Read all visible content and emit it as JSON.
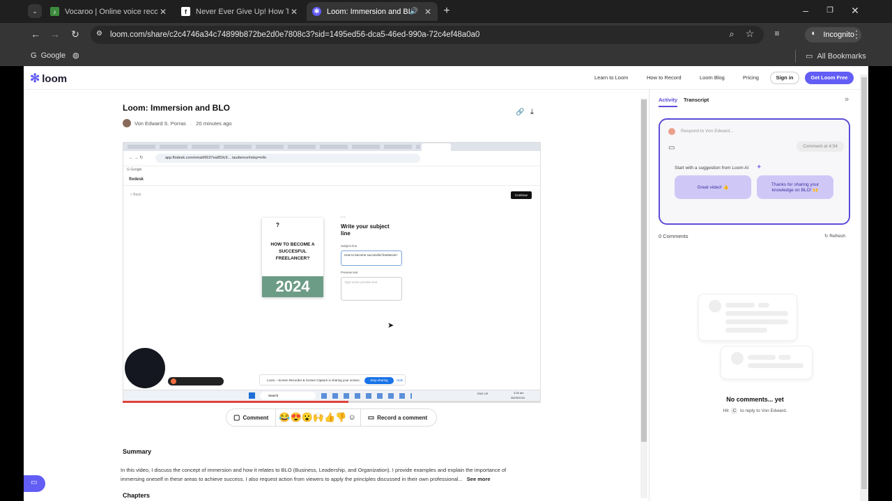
{
  "browser": {
    "tabs": [
      {
        "title": "Vocaroo | Online voice recorder"
      },
      {
        "title": "Never Ever Give Up! How To Be"
      },
      {
        "title": "Loom: Immersion and BLO"
      }
    ],
    "url": "loom.com/share/c2c4746a34c74899b872be2d0e7808c3?sid=1495ed56-dca5-46ed-990a-72c4ef48a0a0",
    "incognito_label": "Incognito",
    "bookmarks": {
      "google": "Google",
      "all": "All Bookmarks"
    }
  },
  "nav": {
    "logo": "loom",
    "links": [
      "Learn to Loom",
      "How to Record",
      "Loom Blog",
      "Pricing"
    ],
    "signin": "Sign in",
    "get": "Get Loom Free"
  },
  "video": {
    "title": "Loom: Immersion and BLO",
    "author": "Von Edward S. Porras",
    "time": "20 minutes ago",
    "progress": 0.54,
    "inner": {
      "url": "app.flodesk.com/email/6637ea859c9... /audience#step=info",
      "brand": "flodesk",
      "back": "< Back",
      "continue": "Continue",
      "heading": "Write your subject line",
      "subject_label": "Subject line",
      "subject_value": "How to become successful freelancer!",
      "preview_label": "Preview text",
      "preview_placeholder": "Type some preview text",
      "cover_q": "?",
      "cover_title": "HOW TO BECOME A SUCCESFUL FREELANCER?",
      "cover_year": "2024",
      "share_msg": "Loom – Screen Recorder & Screen Capture is sharing your screen.",
      "stop": "Stop sharing",
      "hide": "Hide",
      "search": "Search",
      "clock": "4:26 am",
      "date": "06/05/2024",
      "lang": "ENG US"
    }
  },
  "reactions": {
    "comment": "Comment",
    "emojis": [
      "😂",
      "😍",
      "😮",
      "🙌",
      "👍",
      "👎"
    ],
    "record": "Record a comment"
  },
  "summary": {
    "heading": "Summary",
    "text": "In this video, I discuss the concept of immersion and how it relates to BLO (Business, Leadership, and Organization). I provide examples and explain the importance of immersing oneself in these areas to achieve success. I also request action from viewers to apply the principles discussed in their own professional...",
    "see_more": "See more",
    "chapters": "Chapters"
  },
  "sidebar": {
    "tab_activity": "Activity",
    "tab_transcript": "Transcript",
    "respond": "Respond to Von Edward...",
    "comment_at": "Comment at 4:54",
    "suggest_label": "Start with a suggestion from Loom AI",
    "suggestions": [
      "Great video! 👍",
      "Thanks for sharing your knowledge on BLO! 🙌"
    ],
    "count": "0 Comments",
    "refresh": "Refresh",
    "empty_title": "No comments... yet",
    "empty_hint_pre": "Hit",
    "empty_key": "C",
    "empty_hint_post": "to reply to Von Edward."
  }
}
